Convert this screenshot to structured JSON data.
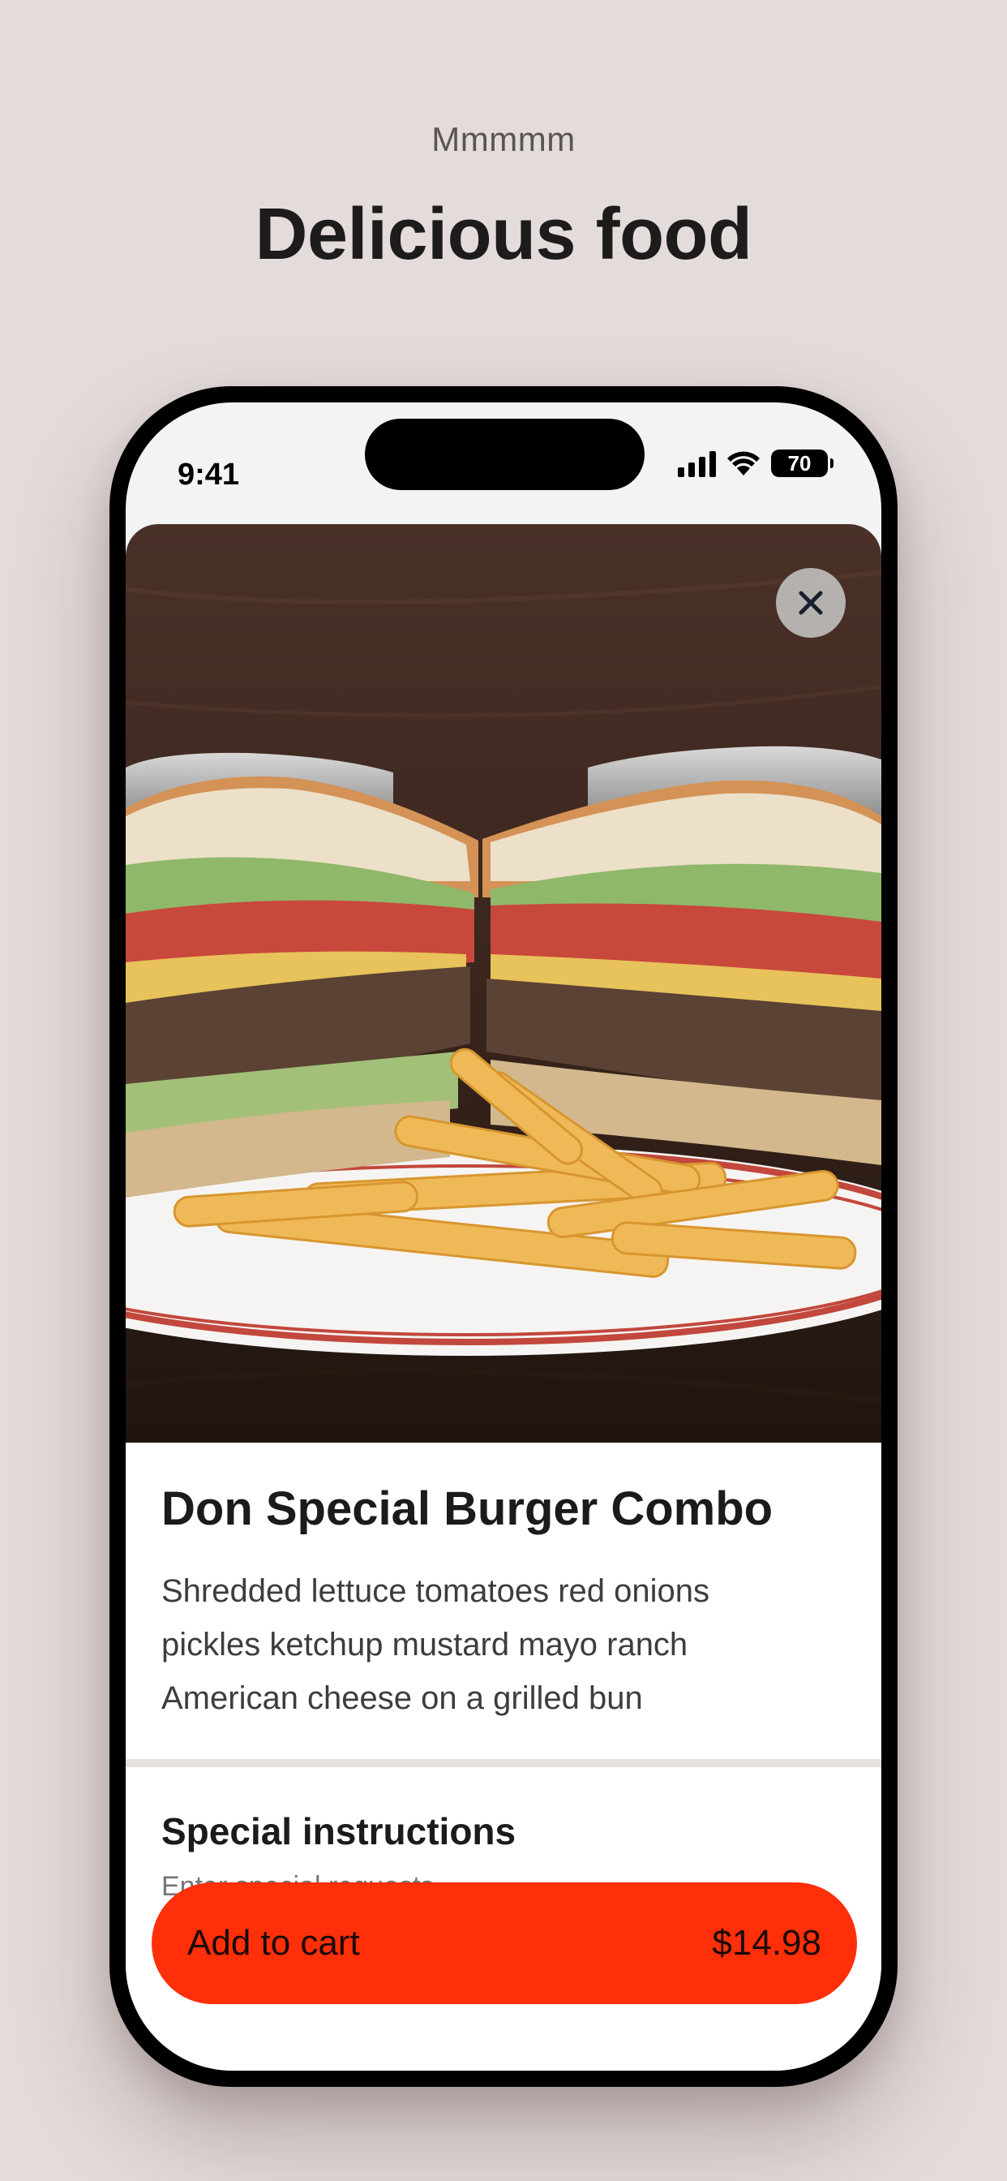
{
  "header": {
    "eyebrow": "Mmmmm",
    "headline": "Delicious food"
  },
  "status_bar": {
    "time": "9:41",
    "battery_level": "70"
  },
  "item": {
    "name": "Don Special Burger Combo",
    "description": "Shredded lettuce tomatoes red onions pickles ketchup mustard mayo ranch American cheese on a grilled bun",
    "image_icon": "burger-photo"
  },
  "instructions": {
    "title": "Special instructions",
    "placeholder": "Enter special requests"
  },
  "cart": {
    "label": "Add to cart",
    "price": "$14.98"
  },
  "colors": {
    "background": "#e4dcda",
    "accent": "#ff2f0a",
    "text": "#1c1b1b"
  }
}
